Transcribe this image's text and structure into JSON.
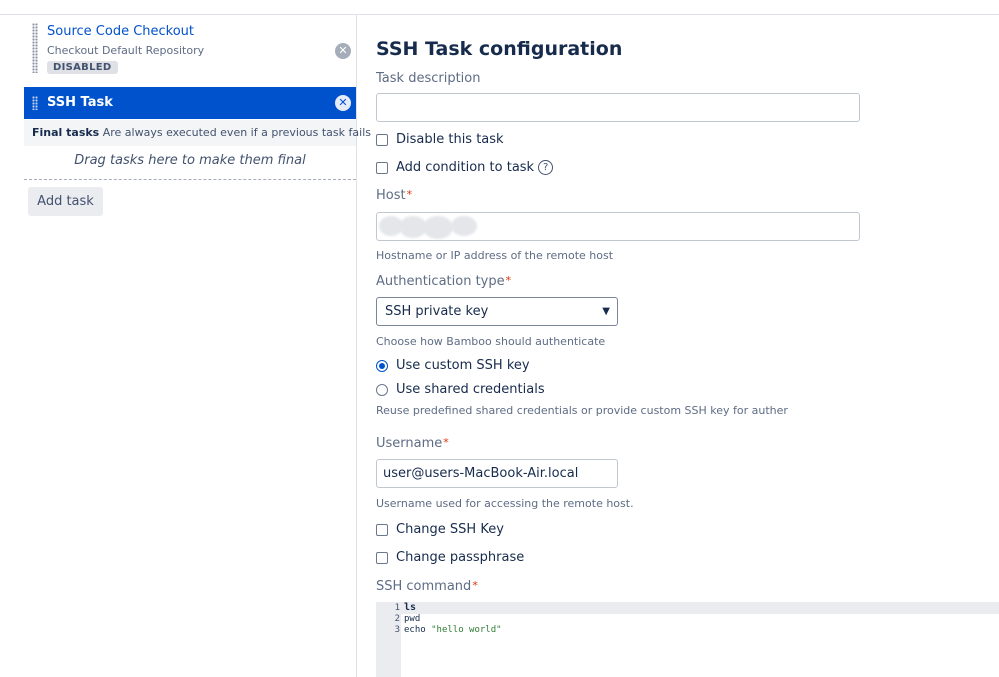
{
  "tasks": [
    {
      "title": "Source Code Checkout",
      "subtitle": "Checkout Default Repository",
      "badge": "DISABLED"
    },
    {
      "title": "SSH Task"
    }
  ],
  "final_tasks": {
    "title": "Final tasks",
    "description": "Are always executed even if a previous task fails",
    "drop_hint": "Drag tasks here to make them final"
  },
  "add_task_label": "Add task",
  "form": {
    "heading": "SSH Task configuration",
    "task_description_label": "Task description",
    "task_description_value": "",
    "disable_task_label": "Disable this task",
    "add_condition_label": "Add condition to task",
    "host_label": "Host",
    "host_hint": "Hostname or IP address of the remote host",
    "auth_type_label": "Authentication type",
    "auth_type_selected": "SSH private key",
    "auth_type_hint": "Choose how Bamboo should authenticate",
    "radio_custom_label": "Use custom SSH key",
    "radio_shared_label": "Use shared credentials",
    "shared_hint": "Reuse predefined shared credentials or provide custom SSH key for auther",
    "username_label": "Username",
    "username_value": "user@users-MacBook-Air.local",
    "username_hint": "Username used for accessing the remote host.",
    "change_key_label": "Change SSH Key",
    "change_passphrase_label": "Change passphrase",
    "ssh_command_label": "SSH command",
    "required_mark": "*",
    "help_glyph": "?"
  },
  "ssh_command": {
    "lines": [
      {
        "n": "1",
        "text": "ls"
      },
      {
        "n": "2",
        "text": "pwd"
      },
      {
        "n": "3",
        "text": "echo",
        "string": "\"hello world\""
      }
    ]
  },
  "colors": {
    "accent": "#0052cc",
    "required": "#de350b",
    "text": "#172b4d",
    "muted": "#5e6c84"
  },
  "icons": {
    "drag_handle": "drag-handle-icon",
    "delete": "remove-circle-icon",
    "help": "question-circle-icon",
    "dropdown": "chevron-down-icon"
  }
}
